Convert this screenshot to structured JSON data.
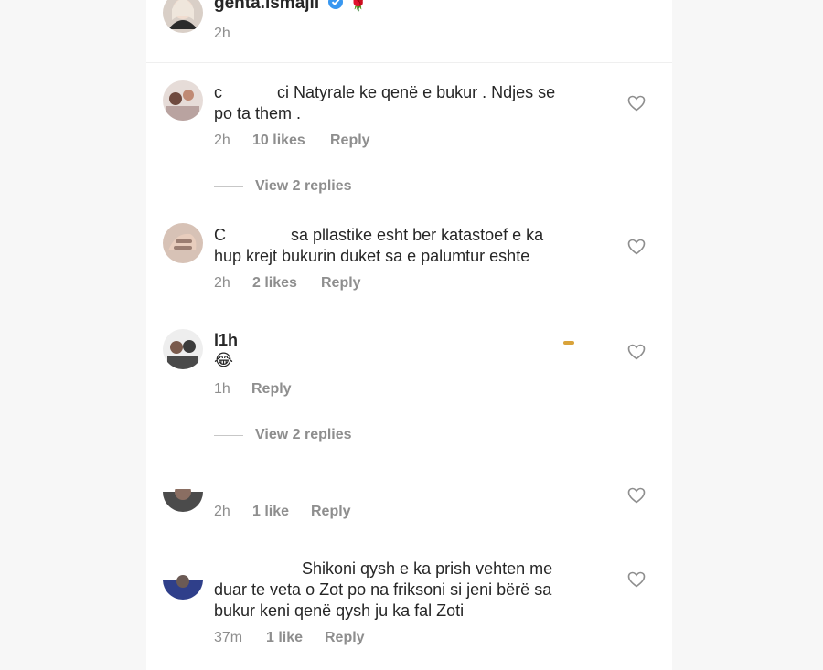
{
  "header": {
    "username": "genta.ismajli",
    "emoji": "🌹",
    "time": "2h"
  },
  "comments": [
    {
      "user_fragment": "c",
      "text_line1": "ci Natyrale ke qenë e bukur . Ndjes se",
      "text_line2": "po ta them .",
      "time": "2h",
      "likes": "10 likes",
      "reply": "Reply",
      "view_replies": "View 2 replies"
    },
    {
      "user_fragment": "C",
      "text_line1": "sa pllastike esht ber katastoef e ka",
      "text_line2": "hup krejt bukurin duket sa e palumtur eshte",
      "time": "2h",
      "likes": "2 likes",
      "reply": "Reply"
    },
    {
      "user_fragment": "l1h",
      "emoji": "😂",
      "time": "1h",
      "reply": "Reply",
      "view_replies": "View 2 replies"
    },
    {
      "time": "2h",
      "likes": "1 like",
      "reply": "Reply"
    },
    {
      "text_line1": "Shikoni qysh e ka prish vehten me",
      "text_line2": "duar te veta o Zot po na friksoni si jeni bërë sa",
      "text_line3": "bukur  keni qenë qysh ju ka fal Zoti",
      "time": "37m",
      "likes": "1 like",
      "reply": "Reply"
    }
  ],
  "colors": {
    "text": "#262626",
    "secondary": "#8e8e8e",
    "verified": "#3897f0",
    "background": "#ffffff"
  }
}
